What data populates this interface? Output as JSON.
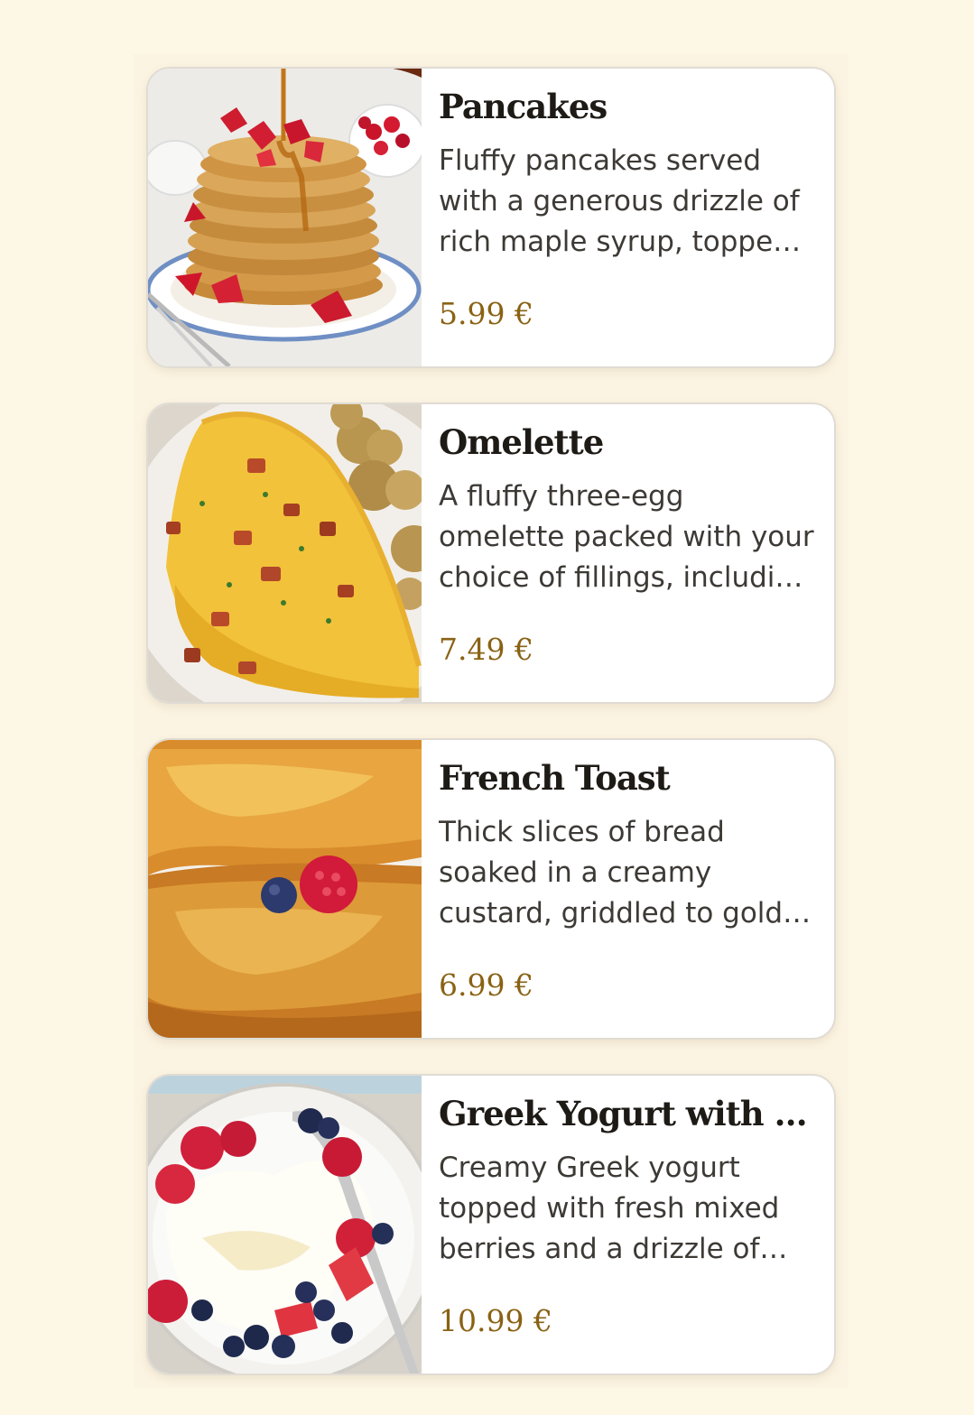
{
  "menu": {
    "items": [
      {
        "title": "Pancakes",
        "description": "Fluffy pancakes served with a generous drizzle of rich maple syrup, topped with fresh strawberries and a dollop of cream.",
        "price": "5.99 €",
        "image_icon": "pancakes-photo"
      },
      {
        "title": "Omelette",
        "description": "A fluffy three-egg omelette packed with your choice of fillings, including bacon, herbs and cheese.",
        "price": "7.49 €",
        "image_icon": "omelette-photo"
      },
      {
        "title": "French Toast",
        "description": "Thick slices of bread soaked in a creamy custard, griddled to golden perfection and served with berries.",
        "price": "6.99 €",
        "image_icon": "french-toast-photo"
      },
      {
        "title": "Greek Yogurt with Honey",
        "description": "Creamy Greek yogurt topped with fresh mixed berries and a drizzle of honey.",
        "price": "10.99 €",
        "image_icon": "greek-yogurt-photo"
      }
    ]
  },
  "colors": {
    "page_background": "#fdf7e6",
    "card_background": "#ffffff",
    "title": "#1e1a16",
    "description": "#3d3a36",
    "price": "#8a6214"
  }
}
